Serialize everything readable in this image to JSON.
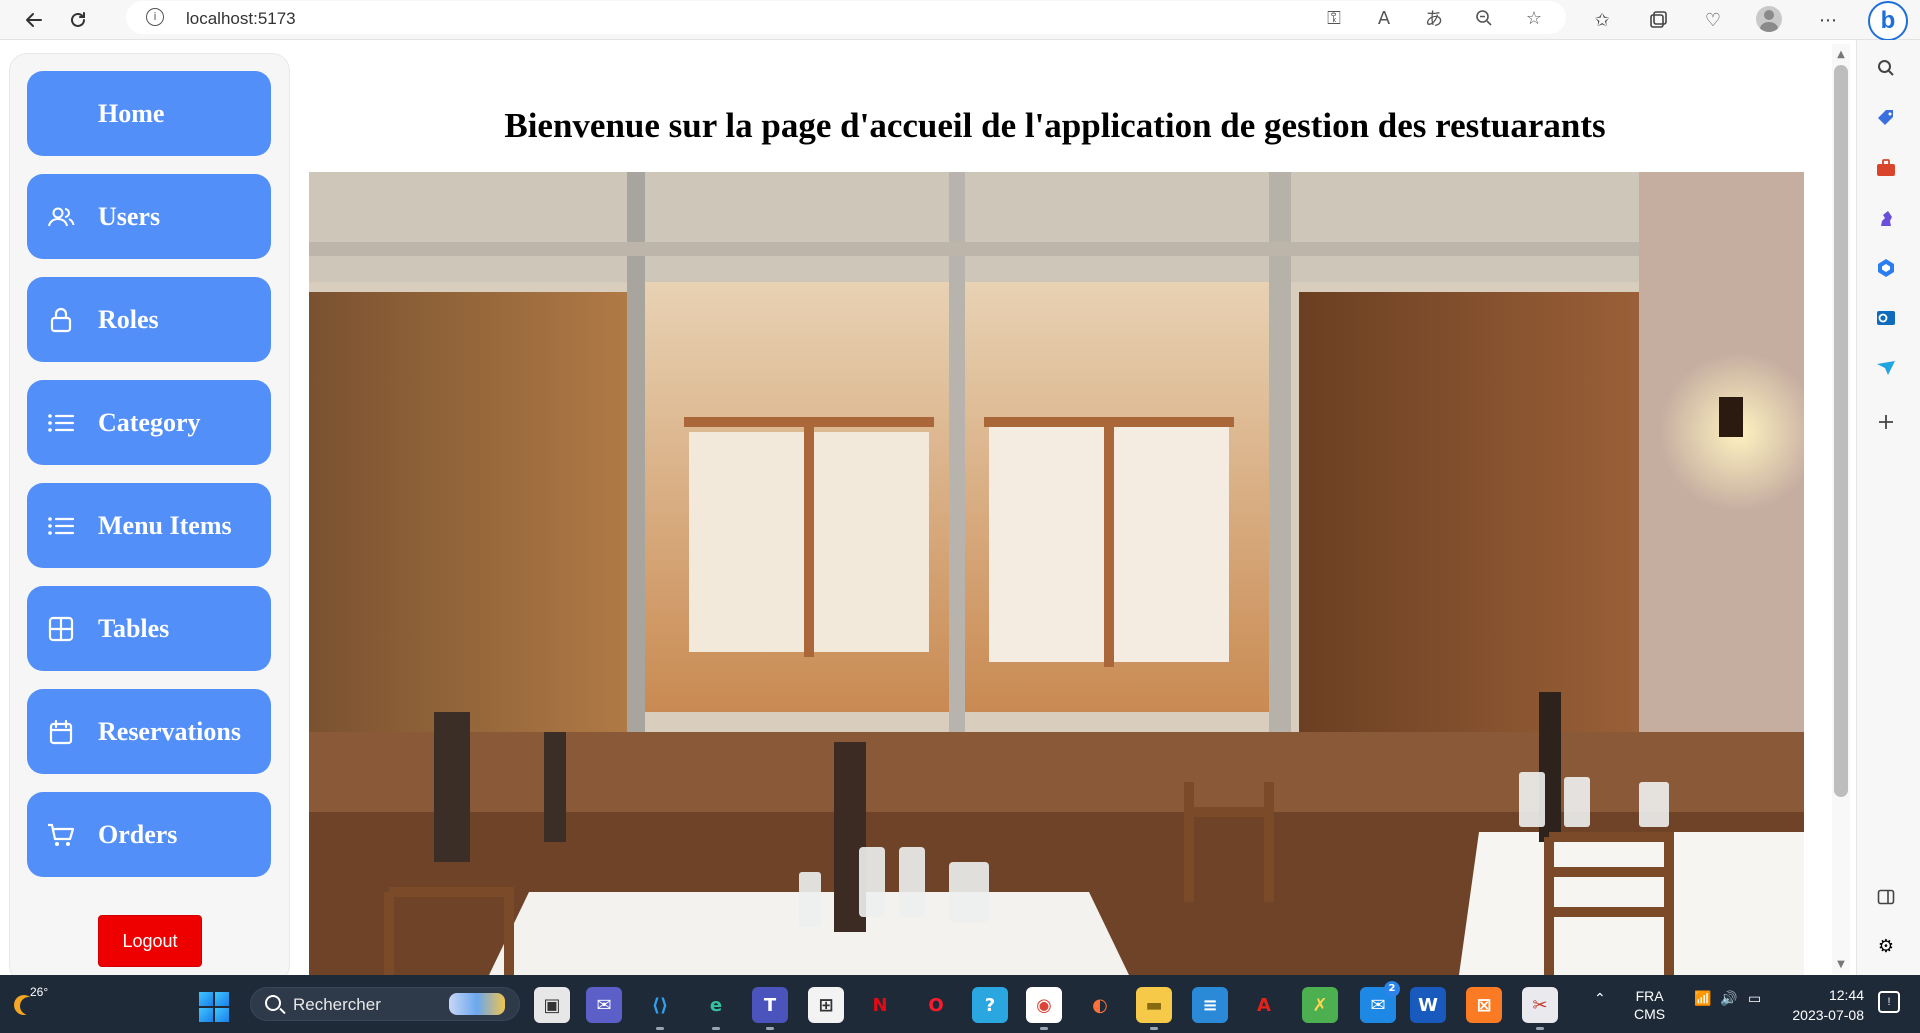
{
  "browser": {
    "url": "localhost:5173"
  },
  "page": {
    "heading": "Bienvenue sur la page d'accueil de l'application de gestion des restuarants"
  },
  "sidebar": {
    "items": [
      {
        "label": "Home",
        "icon": "none"
      },
      {
        "label": "Users",
        "icon": "users-icon"
      },
      {
        "label": "Roles",
        "icon": "lock-icon"
      },
      {
        "label": "Category",
        "icon": "list-icon"
      },
      {
        "label": "Menu Items",
        "icon": "list-icon"
      },
      {
        "label": "Tables",
        "icon": "grid-icon"
      },
      {
        "label": "Reservations",
        "icon": "calendar-icon"
      },
      {
        "label": "Orders",
        "icon": "cart-icon"
      }
    ],
    "logout_label": "Logout"
  },
  "hero": {
    "alt": "restaurant interior"
  },
  "taskbar": {
    "temperature": "26°",
    "search_placeholder": "Rechercher",
    "lang_line1": "FRA",
    "lang_line2": "CMS",
    "time": "12:44",
    "date": "2023-07-08",
    "mail_badge": "2"
  },
  "colors": {
    "nav_button": "#528ff9",
    "logout_button": "#ee0000",
    "taskbar": "#1f2a38"
  }
}
